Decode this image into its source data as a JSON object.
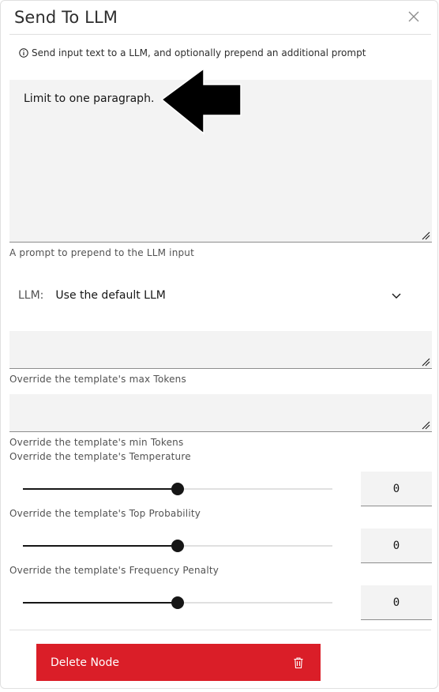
{
  "dialog": {
    "title": "Send To LLM",
    "info_text": "Send input text to a LLM, and optionally prepend an additional prompt"
  },
  "prompt": {
    "value": "Limit to one paragraph.",
    "helper": "A prompt to prepend to the LLM input"
  },
  "llm": {
    "label": "LLM:",
    "selected": "Use the default LLM"
  },
  "max_tokens": {
    "value": "",
    "helper": "Override the template's max Tokens"
  },
  "min_tokens": {
    "value": "",
    "helper": "Override the template's min Tokens"
  },
  "temperature": {
    "helper": "Override the template's Temperature",
    "slider_fraction": 0.5,
    "value": "0"
  },
  "top_probability": {
    "helper": "Override the template's Top Probability",
    "slider_fraction": 0.5,
    "value": "0"
  },
  "frequency_penalty": {
    "helper": "Override the template's Frequency Penalty",
    "slider_fraction": 0.5,
    "value": "0"
  },
  "footer": {
    "delete_label": "Delete Node"
  },
  "icons": {
    "close": "close-icon",
    "info": "info-icon",
    "chevron": "chevron-down-icon",
    "trash": "trash-icon",
    "arrow": "left-arrow-annotation",
    "resize": "resize-handle-icon"
  },
  "colors": {
    "danger": "#da1e28",
    "field_bg": "#f3f3f3",
    "text": "#161616",
    "helper_text": "#525252"
  }
}
